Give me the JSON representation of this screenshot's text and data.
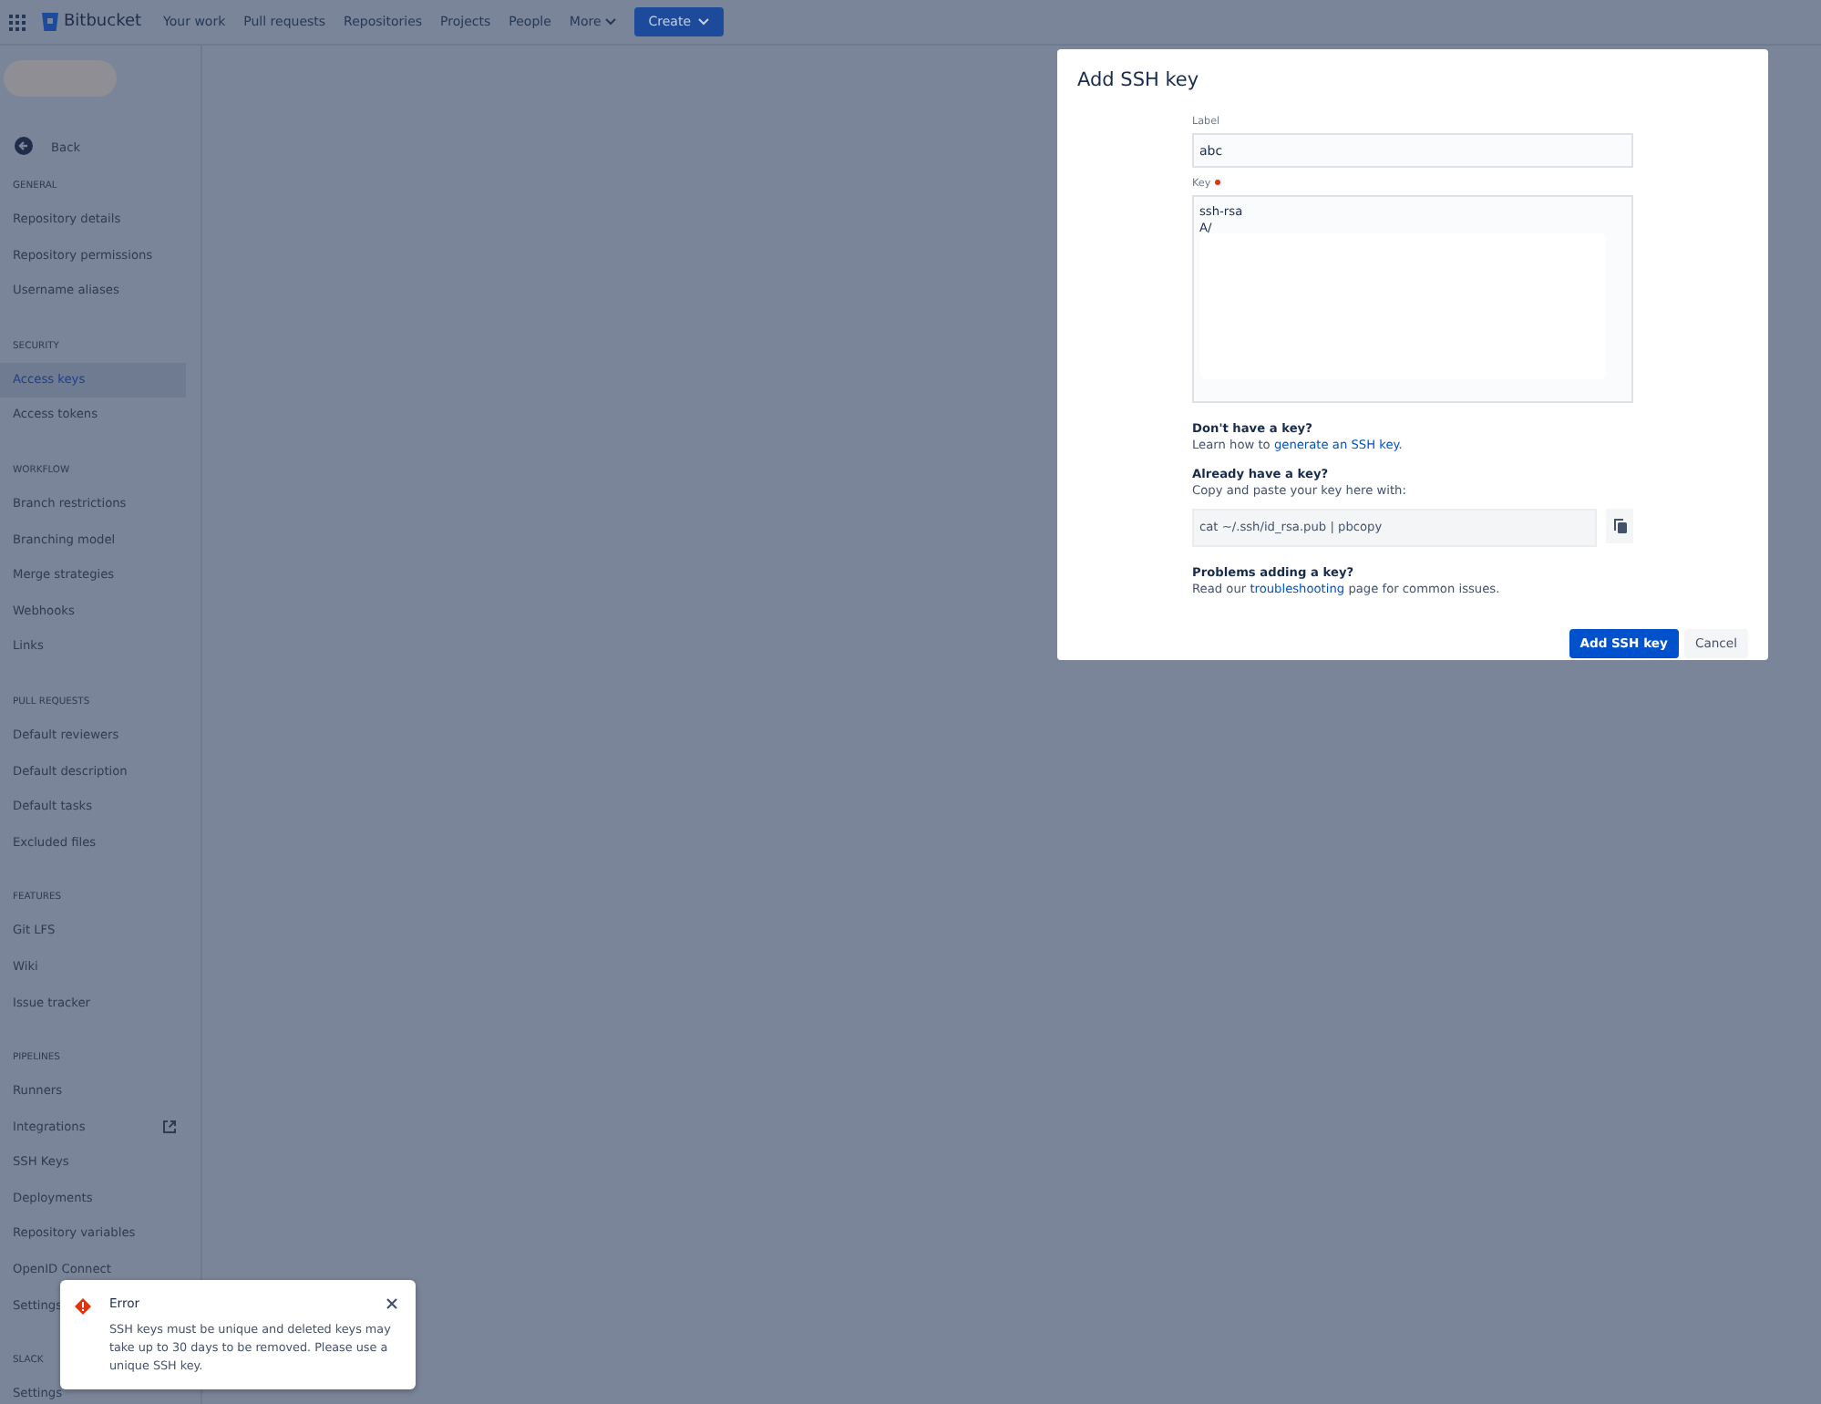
{
  "topbar": {
    "product": "Bitbucket",
    "links": [
      "Your work",
      "Pull requests",
      "Repositories",
      "Projects",
      "People"
    ],
    "more": "More",
    "create": "Create"
  },
  "sidebar": {
    "back": "Back",
    "sections": [
      {
        "heading": "GENERAL",
        "items": [
          {
            "label": "Repository details",
            "selected": false
          },
          {
            "label": "Repository permissions",
            "selected": false
          },
          {
            "label": "Username aliases",
            "selected": false
          }
        ]
      },
      {
        "heading": "SECURITY",
        "items": [
          {
            "label": "Access keys",
            "selected": true
          },
          {
            "label": "Access tokens",
            "selected": false
          }
        ]
      },
      {
        "heading": "WORKFLOW",
        "items": [
          {
            "label": "Branch restrictions",
            "selected": false
          },
          {
            "label": "Branching model",
            "selected": false
          },
          {
            "label": "Merge strategies",
            "selected": false
          },
          {
            "label": "Webhooks",
            "selected": false
          },
          {
            "label": "Links",
            "selected": false
          }
        ]
      },
      {
        "heading": "PULL REQUESTS",
        "items": [
          {
            "label": "Default reviewers",
            "selected": false
          },
          {
            "label": "Default description",
            "selected": false
          },
          {
            "label": "Default tasks",
            "selected": false
          },
          {
            "label": "Excluded files",
            "selected": false
          }
        ]
      },
      {
        "heading": "FEATURES",
        "items": [
          {
            "label": "Git LFS",
            "selected": false
          },
          {
            "label": "Wiki",
            "selected": false
          },
          {
            "label": "Issue tracker",
            "selected": false
          }
        ]
      },
      {
        "heading": "PIPELINES",
        "items": [
          {
            "label": "Runners",
            "selected": false
          },
          {
            "label": "Integrations",
            "selected": false,
            "external": true
          },
          {
            "label": "SSH Keys",
            "selected": false
          },
          {
            "label": "Deployments",
            "selected": false
          },
          {
            "label": "Repository variables",
            "selected": false
          },
          {
            "label": "OpenID Connect",
            "selected": false
          },
          {
            "label": "Settings",
            "selected": false
          }
        ]
      },
      {
        "heading": "SLACK",
        "items": [
          {
            "label": "Settings",
            "selected": false
          }
        ]
      }
    ]
  },
  "dialog": {
    "title": "Add SSH key",
    "label_field": {
      "label": "Label",
      "value": "abc"
    },
    "key_field": {
      "label": "Key",
      "required": true,
      "value": "ssh-rsa\nA/"
    },
    "help": [
      {
        "heading": "Don't have a key?",
        "before": "Learn how to ",
        "link": "generate an SSH key",
        "after": "."
      },
      {
        "heading": "Already have a key?",
        "text": "Copy and paste your key here with:",
        "command": "cat ~/.ssh/id_rsa.pub | pbcopy"
      },
      {
        "heading": "Problems adding a key?",
        "before": "Read our ",
        "link": "troubleshooting",
        "after": " page for common issues."
      }
    ],
    "primary": "Add SSH key",
    "cancel": "Cancel"
  },
  "toast": {
    "title": "Error",
    "message": "SSH keys must be unique and deleted keys may take up to 30 days to be removed. Please use a unique SSH key."
  }
}
